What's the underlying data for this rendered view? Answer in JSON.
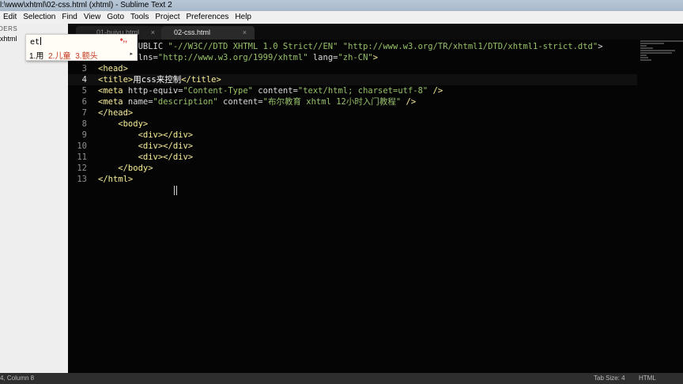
{
  "window": {
    "title": "l:\\www\\xhtml\\02-css.html (xhtml) - Sublime Text 2"
  },
  "menu": [
    "Edit",
    "Selection",
    "Find",
    "View",
    "Goto",
    "Tools",
    "Project",
    "Preferences",
    "Help"
  ],
  "sidebar": {
    "header": "DERS",
    "item": "xhtml"
  },
  "tabs": [
    {
      "label": "01-huiyu.html",
      "close": "×"
    },
    {
      "label": "02-css.html",
      "close": "×"
    }
  ],
  "code_lines": [
    {
      "num": "",
      "segs": [
        {
          "t": "E html PUBLIC ",
          "c": "tagd"
        },
        {
          "t": "\"-//W3C//DTD XHTML 1.0 Strict//EN\"",
          "c": "str"
        },
        {
          "t": " ",
          "c": "plain"
        },
        {
          "t": "\"http://www.w3.org/TR/xhtml1/DTD/xhtml1-strict.dtd\"",
          "c": "str"
        },
        {
          "t": ">",
          "c": "tagd"
        }
      ]
    },
    {
      "num": "2",
      "segs": [
        {
          "t": "<html",
          "c": "tag"
        },
        {
          "t": " xmlns=",
          "c": "attr"
        },
        {
          "t": "\"http://www.w3.org/1999/xhtml\"",
          "c": "str"
        },
        {
          "t": " lang=",
          "c": "attr"
        },
        {
          "t": "\"zh-CN\"",
          "c": "str"
        },
        {
          "t": ">",
          "c": "tag"
        }
      ]
    },
    {
      "num": "3",
      "segs": [
        {
          "t": "<head>",
          "c": "tag"
        }
      ]
    },
    {
      "num": "4",
      "segs": [
        {
          "t": "<title>",
          "c": "tag"
        },
        {
          "t": "用css来控制",
          "c": "plain"
        },
        {
          "t": "</title>",
          "c": "tag"
        }
      ],
      "current": true
    },
    {
      "num": "5",
      "segs": [
        {
          "t": "<meta",
          "c": "tag"
        },
        {
          "t": " http-equiv=",
          "c": "attr"
        },
        {
          "t": "\"Content-Type\"",
          "c": "str"
        },
        {
          "t": " content=",
          "c": "attr"
        },
        {
          "t": "\"text/html; charset=utf-8\"",
          "c": "str"
        },
        {
          "t": " />",
          "c": "tag"
        }
      ]
    },
    {
      "num": "6",
      "segs": [
        {
          "t": "<meta",
          "c": "tag"
        },
        {
          "t": " name=",
          "c": "attr"
        },
        {
          "t": "\"description\"",
          "c": "str"
        },
        {
          "t": " content=",
          "c": "attr"
        },
        {
          "t": "\"布尔教育 xhtml 12小时入门教程\"",
          "c": "str"
        },
        {
          "t": " />",
          "c": "tag"
        }
      ]
    },
    {
      "num": "7",
      "segs": [
        {
          "t": "</head>",
          "c": "tag"
        }
      ]
    },
    {
      "num": "8",
      "segs": [
        {
          "t": "    <body>",
          "c": "tag"
        }
      ]
    },
    {
      "num": "9",
      "segs": [
        {
          "t": "        <div></div>",
          "c": "tag"
        }
      ]
    },
    {
      "num": "10",
      "segs": [
        {
          "t": "        <div></div>",
          "c": "tag"
        }
      ]
    },
    {
      "num": "11",
      "segs": [
        {
          "t": "        <div></div>",
          "c": "tag"
        }
      ]
    },
    {
      "num": "12",
      "segs": [
        {
          "t": "    </body>",
          "c": "tag"
        }
      ]
    },
    {
      "num": "13",
      "segs": [
        {
          "t": "</html>",
          "c": "tag"
        }
      ]
    }
  ],
  "ime": {
    "composition": "et",
    "logo": "⬩,,",
    "candidates": [
      "1.用",
      "2.儿童",
      "3.额头"
    ],
    "next": "▸"
  },
  "status": {
    "position": "4, Column 8",
    "tab_size": "Tab Size: 4",
    "syntax": "HTML"
  }
}
